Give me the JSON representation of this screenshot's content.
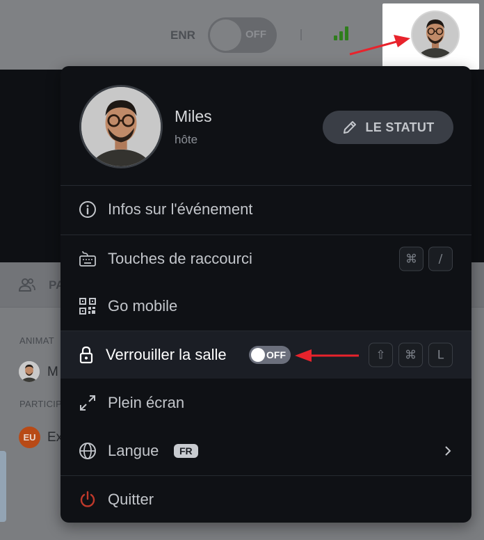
{
  "topbar": {
    "rec_label": "ENR",
    "rec_toggle": "OFF"
  },
  "sidebar": {
    "tab_label": "PA",
    "host_section": "ANIMAT",
    "host_name": "M",
    "participants_section": "PARTICIP",
    "participant_badge": "EU",
    "participant_name": "Ex"
  },
  "menu": {
    "profile": {
      "name": "Miles",
      "role": "hôte",
      "status_button": "LE STATUT"
    },
    "items": [
      {
        "label": "Infos sur l'événement",
        "icon": "info-icon"
      },
      {
        "label": "Touches de raccourci",
        "icon": "keyboard-icon",
        "shortcut": [
          "⌘",
          "/"
        ]
      },
      {
        "label": "Go mobile",
        "icon": "qr-code-icon"
      },
      {
        "label": "Verrouiller la salle",
        "icon": "lock-icon",
        "toggle": "OFF",
        "shortcut": [
          "⇧",
          "⌘",
          "L"
        ]
      },
      {
        "label": "Plein écran",
        "icon": "expand-icon"
      },
      {
        "label": "Langue",
        "icon": "globe-icon",
        "badge": "FR"
      },
      {
        "label": "Quitter",
        "icon": "power-icon"
      }
    ]
  },
  "colors": {
    "menu_bg": "#0f1115",
    "highlight_bg": "#1b1e25",
    "quit_icon": "#c0392b",
    "annotation_arrow": "#e8232c",
    "signal": "#2f7d1c"
  }
}
